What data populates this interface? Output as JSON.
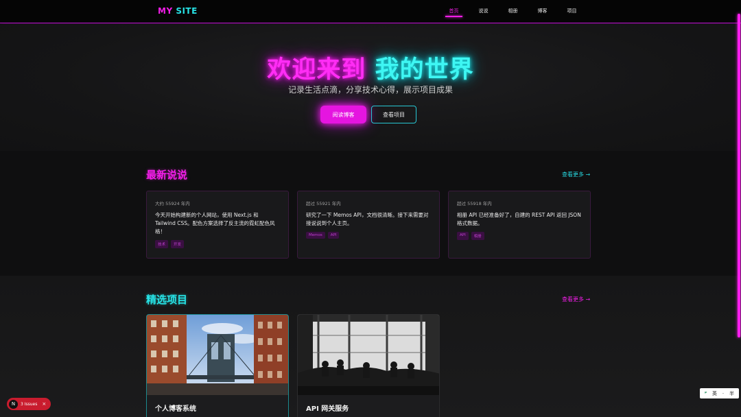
{
  "header": {
    "logo_part1": "MY",
    "logo_part2": "SITE",
    "nav": [
      "首页",
      "说说",
      "相册",
      "博客",
      "项目"
    ],
    "active_nav": "首页"
  },
  "hero": {
    "title_part1": "欢迎来到",
    "title_part2": "我的世界",
    "subtitle": "记录生活点滴，分享技术心得，展示项目成果",
    "primary_button": "阅读博客",
    "secondary_button": "查看项目"
  },
  "memos": {
    "title": "最新说说",
    "more": "查看更多 →",
    "items": [
      {
        "date": "大约 55924 年内",
        "text": "今天开始构建新的个人网站，使用 Next.js 和 Tailwind CSS。配色方案选择了反主流的霓虹配色风格！",
        "tags": [
          "技术",
          "开发"
        ]
      },
      {
        "date": "超过 55921 年内",
        "text": "研究了一下 Memos API，文档很清晰。接下来需要对接说说到个人主页。",
        "tags": [
          "Memos",
          "API"
        ]
      },
      {
        "date": "超过 55918 年内",
        "text": "相册 API 已经准备好了，自建的 REST API 返回 JSON 格式数据。",
        "tags": [
          "API",
          "相册"
        ]
      }
    ]
  },
  "projects": {
    "title": "精选项目",
    "more": "查看更多 →",
    "items": [
      {
        "title": "个人博客系统"
      },
      {
        "title": "API 网关服务"
      }
    ]
  },
  "widgets": {
    "issues_badge": "N",
    "issues_text": "3 Issues",
    "issues_close": "×",
    "ime": [
      "英",
      "·",
      "半"
    ]
  },
  "colors": {
    "neon_pink": "#f21ee8",
    "neon_cyan": "#27e3e6",
    "background": "#0b0b0d"
  }
}
